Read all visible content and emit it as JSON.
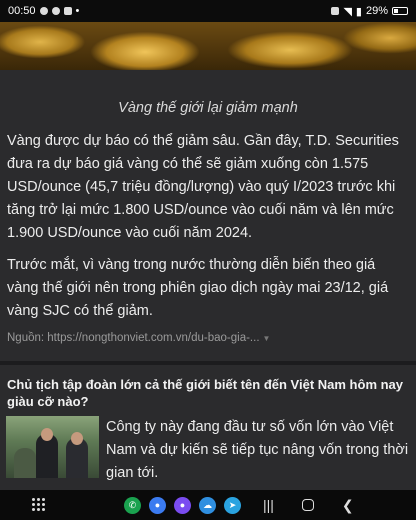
{
  "status_bar": {
    "time": "00:50",
    "battery": "29%"
  },
  "article": {
    "caption": "Vàng thế giới lại giảm mạnh",
    "paragraph_1": "Vàng được dự báo có thể giảm sâu. Gần đây, T.D. Securities đưa ra dự báo giá vàng có thể sẽ giảm xuống còn 1.575 USD/ounce (45,7 triệu đồng/lượng) vào quý I/2023 trước khi tăng trở lại mức 1.800 USD/ounce vào cuối năm và lên mức 1.900 USD/ounce vào cuối năm 2024.",
    "paragraph_2": "Trước mắt, vì vàng trong nước thường diễn biến theo giá vàng thế giới nên trong phiên giao dịch ngày mai 23/12, giá vàng SJC có thể giảm.",
    "source": "Nguồn: https://nongthonviet.com.vn/du-bao-gia-..."
  },
  "related": {
    "title": "Chủ tịch tập đoàn lớn cả thế giới biết tên đến Việt Nam hôm nay giàu cỡ nào?",
    "description": "Công ty này đang đầu tư số vốn lớn vào Việt Nam và dự kiến sẽ tiếp tục nâng vốn trong thời gian tới."
  },
  "nav": {
    "apps": [
      {
        "icon": "phone-app-icon",
        "color": "#1aa24f",
        "glyph": "✆"
      },
      {
        "icon": "messages-app-icon",
        "color": "#3b7bf0",
        "glyph": "●"
      },
      {
        "icon": "messenger-app-icon",
        "color": "#7a4cf0",
        "glyph": "●"
      },
      {
        "icon": "weather-app-icon",
        "color": "#2f8fe0",
        "glyph": "☁"
      },
      {
        "icon": "telegram-app-icon",
        "color": "#2aa3e0",
        "glyph": "➤"
      }
    ]
  },
  "colors": {
    "background": "#2b2b2d",
    "text": "#ececec",
    "gold": "#e0b44a"
  }
}
